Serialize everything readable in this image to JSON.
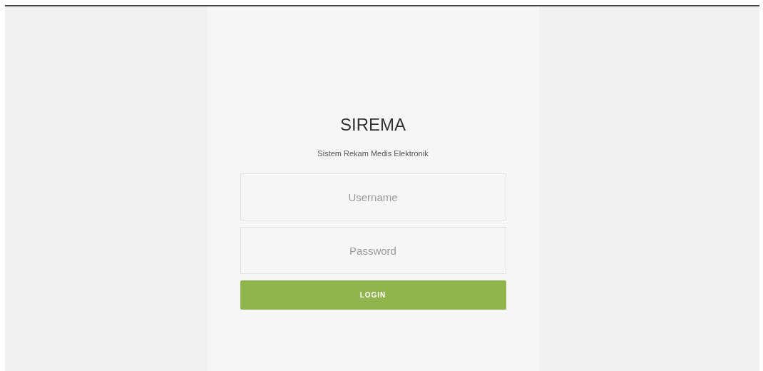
{
  "title": "SIREMA",
  "subtitle": "Sistem Rekam Medis Elektronik",
  "fields": [
    {
      "placeholder": "Username"
    },
    {
      "placeholder": "Password"
    }
  ],
  "button": "LOGIN"
}
